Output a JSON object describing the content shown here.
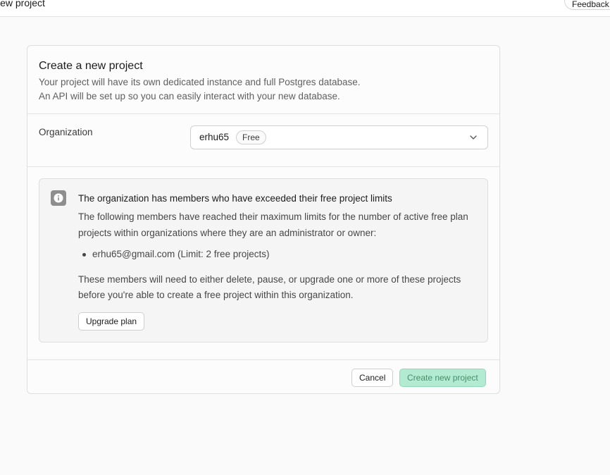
{
  "header": {
    "title": "New project",
    "feedback_label": "Feedback"
  },
  "card": {
    "title": "Create a new project",
    "description_line1": "Your project will have its own dedicated instance and full Postgres database.",
    "description_line2": "An API will be set up so you can easily interact with your new database."
  },
  "organization": {
    "label": "Organization",
    "selected_value": "erhu65",
    "plan_badge": "Free"
  },
  "alert": {
    "title": "The organization has members who have exceeded their free project limits",
    "body": "The following members have reached their maximum limits for the number of active free plan projects within organizations where they are an administrator or owner:",
    "members": [
      "erhu65@gmail.com (Limit: 2 free projects)"
    ],
    "body2": "These members will need to either delete, pause, or upgrade one or more of these projects before you're able to create a free project within this organization.",
    "upgrade_label": "Upgrade plan"
  },
  "footer": {
    "cancel_label": "Cancel",
    "create_label": "Create new project"
  },
  "colors": {
    "accent_disabled": "#b2ebd1",
    "accent_text_disabled": "#4a8d6e"
  },
  "icons": {
    "info": "info-icon",
    "chevron": "chevron-down-icon"
  }
}
